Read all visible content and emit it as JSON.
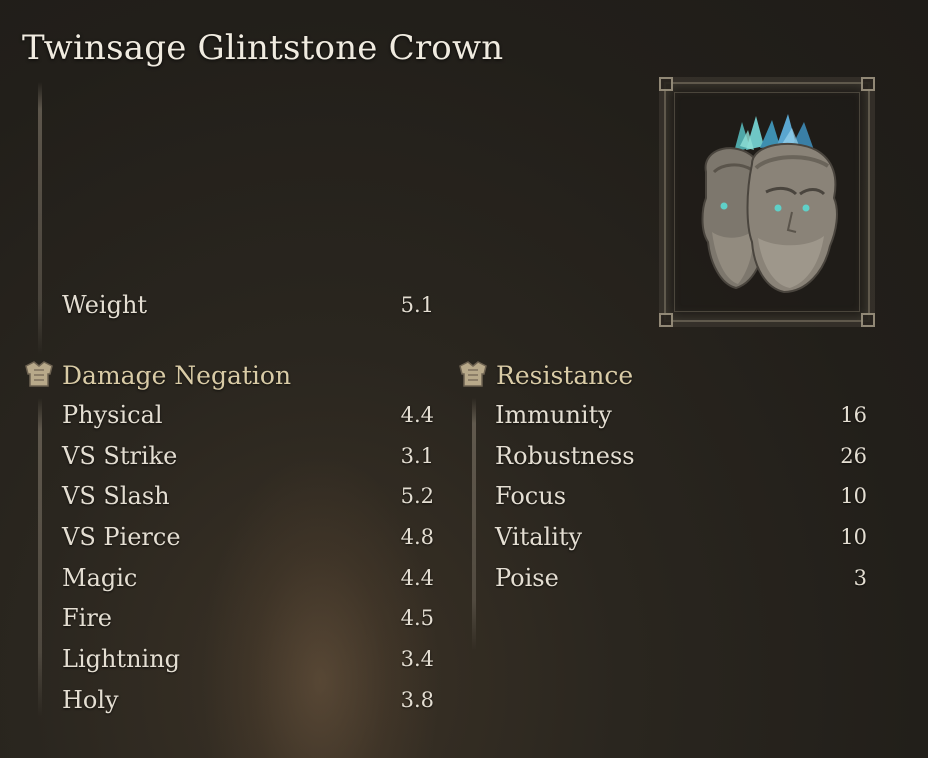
{
  "item": {
    "name": "Twinsage Glintstone Crown",
    "image_icon": "twinsage-glintstone-crown-icon"
  },
  "weight": {
    "label": "Weight",
    "value": "5.1"
  },
  "damage_negation": {
    "title": "Damage Negation",
    "icon": "chest-armor-icon",
    "stats": [
      {
        "label": "Physical",
        "value": "4.4"
      },
      {
        "label": "VS Strike",
        "value": "3.1"
      },
      {
        "label": "VS Slash",
        "value": "5.2"
      },
      {
        "label": "VS Pierce",
        "value": "4.8"
      },
      {
        "label": "Magic",
        "value": "4.4"
      },
      {
        "label": "Fire",
        "value": "4.5"
      },
      {
        "label": "Lightning",
        "value": "3.4"
      },
      {
        "label": "Holy",
        "value": "3.8"
      }
    ]
  },
  "resistance": {
    "title": "Resistance",
    "icon": "chest-armor-icon",
    "stats": [
      {
        "label": "Immunity",
        "value": "16"
      },
      {
        "label": "Robustness",
        "value": "26"
      },
      {
        "label": "Focus",
        "value": "10"
      },
      {
        "label": "Vitality",
        "value": "10"
      },
      {
        "label": "Poise",
        "value": "3"
      }
    ]
  },
  "colors": {
    "background": "#221f1a",
    "text": "#e4ded2",
    "section_heading": "#d9cba6",
    "crystal": "#5fb8c2"
  }
}
